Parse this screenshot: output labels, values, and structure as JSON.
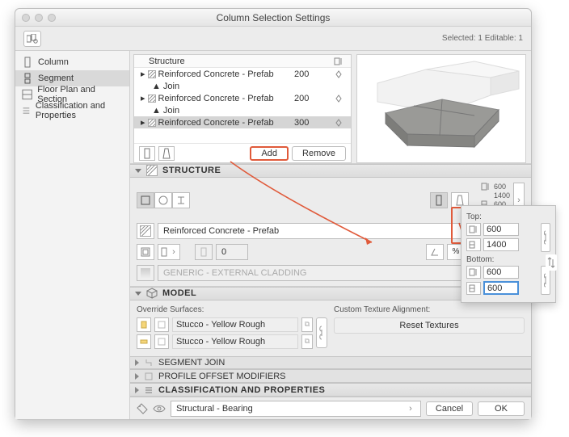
{
  "window": {
    "title": "Column Selection Settings",
    "status": "Selected: 1 Editable: 1"
  },
  "sidebar": {
    "items": [
      {
        "label": "Column"
      },
      {
        "label": "Segment"
      },
      {
        "label": "Floor Plan and Section"
      },
      {
        "label": "Classification and Properties"
      }
    ]
  },
  "segment_list": {
    "header": "Structure",
    "rows": [
      {
        "name": "Reinforced Concrete - Prefab",
        "value": "200",
        "join": false
      },
      {
        "name": "Join",
        "value": "",
        "join": true
      },
      {
        "name": "Reinforced Concrete - Prefab",
        "value": "200",
        "join": false
      },
      {
        "name": "Join",
        "value": "",
        "join": true
      },
      {
        "name": "Reinforced Concrete - Prefab",
        "value": "300",
        "join": false
      }
    ],
    "add_label": "Add",
    "remove_label": "Remove"
  },
  "structure": {
    "title": "STRUCTURE",
    "material": "Reinforced Concrete - Prefab",
    "spin_value": "0",
    "dim_a": "600",
    "dim_b": "1400",
    "dim_c": "600",
    "dim_d": "600",
    "highlight_value": "300",
    "cladding": "GENERIC - EXTERNAL CLADDING"
  },
  "model": {
    "title": "MODEL",
    "override_label": "Override Surfaces:",
    "surface_name": "Stucco - Yellow Rough",
    "custom_label": "Custom Texture Alignment:",
    "reset_label": "Reset Textures"
  },
  "sections": {
    "segment_join": "SEGMENT JOIN",
    "profile_offset": "PROFILE OFFSET MODIFIERS",
    "classification": "CLASSIFICATION AND PROPERTIES"
  },
  "footer": {
    "tag": "Structural - Bearing",
    "cancel": "Cancel",
    "ok": "OK"
  },
  "popout": {
    "top_label": "Top:",
    "bottom_label": "Bottom:",
    "top_a": "600",
    "top_b": "1400",
    "bot_a": "600",
    "bot_b": "600"
  }
}
